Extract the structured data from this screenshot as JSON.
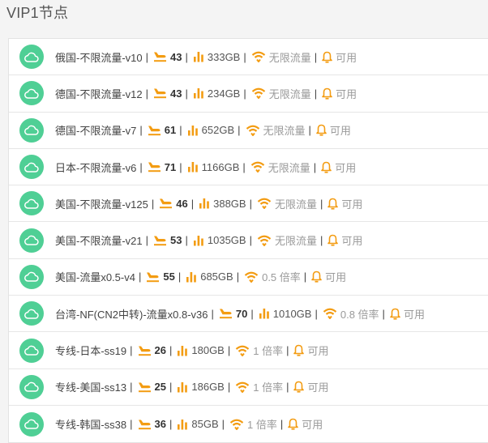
{
  "page": {
    "title": "VIP1节点"
  },
  "colors": {
    "cloud": "#4fcf95",
    "orange": "#f39c12",
    "grey": "#9a9a9a"
  },
  "icons": [
    "cloud-icon",
    "plane-icon",
    "bar-chart-icon",
    "wifi-icon",
    "bell-icon"
  ],
  "nodes": [
    {
      "name": "俄国-不限流量-v10",
      "online": "43",
      "traffic": "333GB",
      "rate": "无限流量",
      "status": "可用"
    },
    {
      "name": "德国-不限流量-v12",
      "online": "43",
      "traffic": "234GB",
      "rate": "无限流量",
      "status": "可用"
    },
    {
      "name": "德国-不限流量-v7",
      "online": "61",
      "traffic": "652GB",
      "rate": "无限流量",
      "status": "可用"
    },
    {
      "name": "日本-不限流量-v6",
      "online": "71",
      "traffic": "1166GB",
      "rate": "无限流量",
      "status": "可用"
    },
    {
      "name": "美国-不限流量-v125",
      "online": "46",
      "traffic": "388GB",
      "rate": "无限流量",
      "status": "可用"
    },
    {
      "name": "美国-不限流量-v21",
      "online": "53",
      "traffic": "1035GB",
      "rate": "无限流量",
      "status": "可用"
    },
    {
      "name": "美国-流量x0.5-v4",
      "online": "55",
      "traffic": "685GB",
      "rate": "0.5 倍率",
      "status": "可用"
    },
    {
      "name": "台湾-NF(CN2中转)-流量x0.8-v36",
      "online": "70",
      "traffic": "1010GB",
      "rate": "0.8 倍率",
      "status": "可用"
    },
    {
      "name": "专线-日本-ss19",
      "online": "26",
      "traffic": "180GB",
      "rate": "1 倍率",
      "status": "可用"
    },
    {
      "name": "专线-美国-ss13",
      "online": "25",
      "traffic": "186GB",
      "rate": "1 倍率",
      "status": "可用"
    },
    {
      "name": "专线-韩国-ss38",
      "online": "36",
      "traffic": "85GB",
      "rate": "1 倍率",
      "status": "可用"
    }
  ]
}
